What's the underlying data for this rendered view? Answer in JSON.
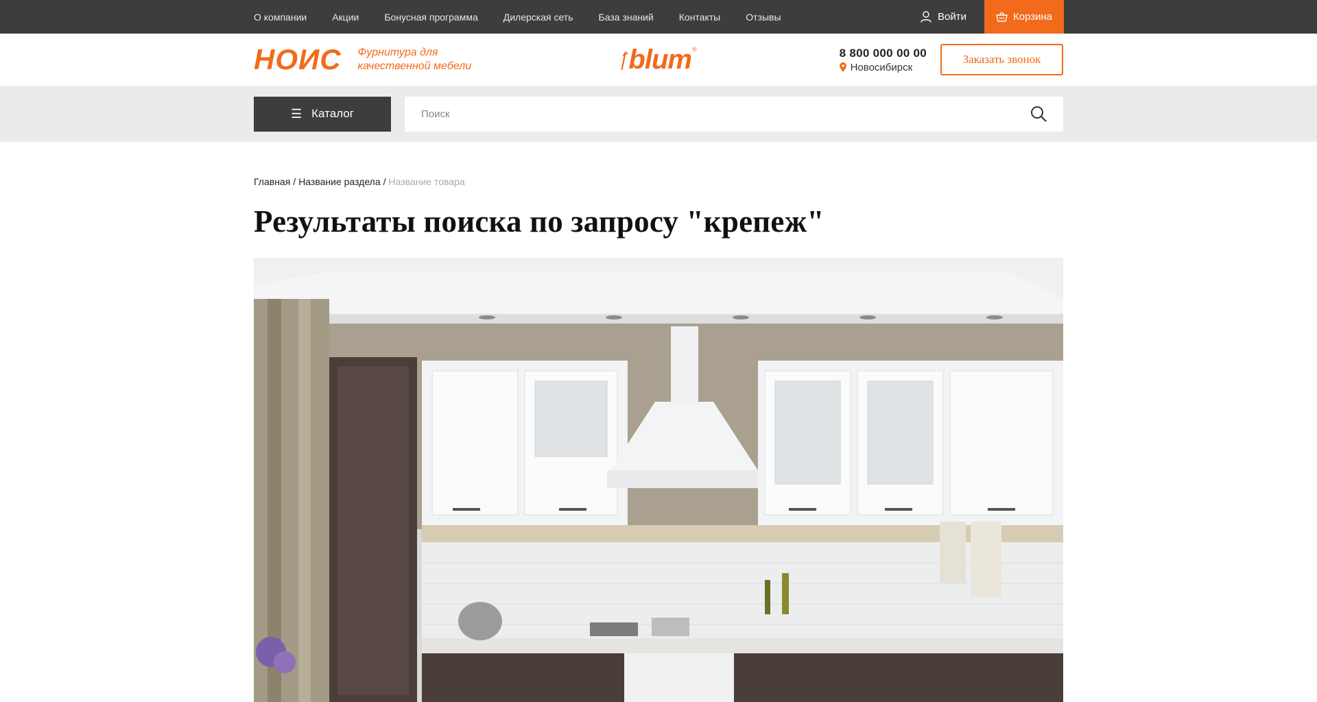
{
  "topbar": {
    "nav": [
      "О компании",
      "Акции",
      "Бонусная программа",
      "Дилерская сеть",
      "База знаний",
      "Контакты",
      "Отзывы"
    ],
    "login_label": "Войти",
    "cart_label": "Корзина"
  },
  "header": {
    "logo_text": "НОИС",
    "logo_tagline_1": "Фурнитура для",
    "logo_tagline_2": "качественной мебели",
    "brand_text": "blum",
    "brand_reg": "®",
    "phone": "8 800 000 00 00",
    "city": "Новосибирск",
    "callback_label": "Заказать звонок"
  },
  "search": {
    "catalog_label": "Каталог",
    "placeholder": "Поиск"
  },
  "breadcrumbs": {
    "home": "Главная",
    "section": "Название раздела",
    "current": "Название товара"
  },
  "page": {
    "title": "Результаты поиска по запросу \"крепеж\""
  },
  "colors": {
    "accent": "#f26a1b",
    "dark": "#3d3d3d",
    "strip": "#ebebeb"
  }
}
